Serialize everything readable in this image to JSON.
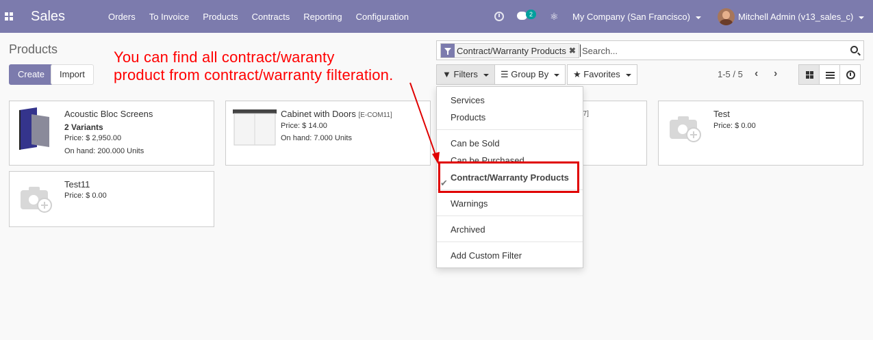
{
  "navbar": {
    "app_name": "Sales",
    "menu": [
      "Orders",
      "To Invoice",
      "Products",
      "Contracts",
      "Reporting",
      "Configuration"
    ],
    "chat_badge": "2",
    "company": "My Company (San Francisco)",
    "user": "Mitchell Admin (v13_sales_c)",
    "bug_icon": "bug-icon"
  },
  "control_panel": {
    "breadcrumb": "Products",
    "create_label": "Create",
    "import_label": "Import",
    "search": {
      "facet_label": "Contract/Warranty Products",
      "placeholder": "Search..."
    },
    "filters_label": "Filters",
    "group_by_label": "Group By",
    "favorites_label": "Favorites",
    "pager": "1-5 / 5"
  },
  "annotation": {
    "line1": "You can find all contract/waranty",
    "line2": "product from contract/warranty filteration."
  },
  "filters_menu": {
    "items": [
      "Services",
      "Products",
      "Can be Sold",
      "Can be Purchased",
      "Contract/Warranty Products",
      "Warnings",
      "Archived",
      "Add Custom Filter"
    ],
    "checked_item": "Contract/Warranty Products"
  },
  "cards": [
    {
      "title": "Acoustic Bloc Screens",
      "variants": "2 Variants",
      "price": "Price: $ 2,950.00",
      "on_hand": "On hand: 200.000 Units"
    },
    {
      "title": "Cabinet with Doors",
      "ref": "[E-COM11]",
      "price": "Price: $ 14.00",
      "on_hand": "On hand: 7.000 Units"
    },
    {
      "title_fragment": "07]"
    },
    {
      "title": "Test",
      "price": "Price: $ 0.00"
    },
    {
      "title": "Test11",
      "price": "Price: $ 0.00"
    }
  ],
  "colors": {
    "brand": "#7c7bad",
    "annotation": "#ff0000",
    "highlight": "#e00000"
  }
}
